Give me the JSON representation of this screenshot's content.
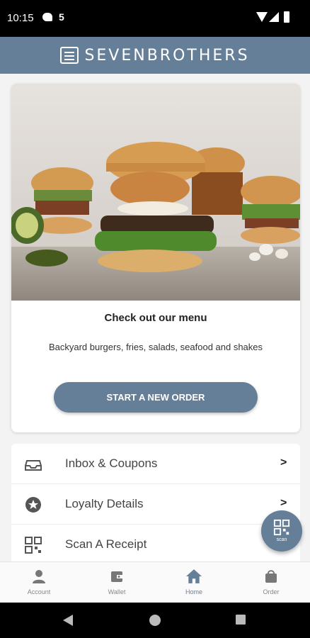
{
  "status_bar": {
    "time": "10:15",
    "notif_b": "5"
  },
  "header": {
    "brand": "SEVENBROTHERS"
  },
  "hero": {
    "image_alt": "burgers-photo",
    "title": "Check out our menu",
    "subtitle": "Backyard burgers, fries, salads, seafood and shakes",
    "button_label": "START A NEW ORDER"
  },
  "list": [
    {
      "label": "Inbox & Coupons",
      "icon": "inbox-icon"
    },
    {
      "label": "Loyalty Details",
      "icon": "star-icon"
    },
    {
      "label": "Scan A Receipt",
      "icon": "qr-icon"
    }
  ],
  "fab": {
    "label": "scan"
  },
  "bottom_nav": [
    {
      "label": "Account",
      "icon": "person-icon"
    },
    {
      "label": "Wallet",
      "icon": "wallet-icon"
    },
    {
      "label": "Home",
      "icon": "home-icon",
      "active": true
    },
    {
      "label": "Order",
      "icon": "bag-icon"
    }
  ],
  "colors": {
    "brand": "#667f99",
    "active_nav": "#667f99",
    "inactive_nav": "#888888"
  }
}
